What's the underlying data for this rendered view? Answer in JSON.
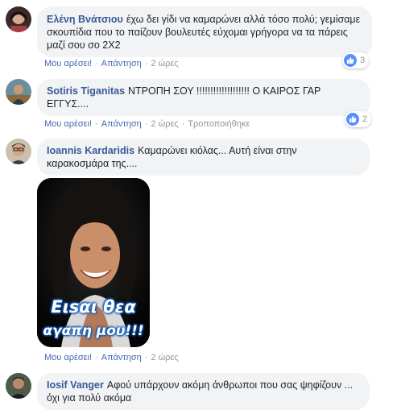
{
  "comments": [
    {
      "author": "Ελένη Βνάτσιου",
      "text": "έχω δει γίδι να καμαρώνει αλλά τόσο πολύ; γεμίσαμε σκουπίδια που το παίζουν βουλευτές εύχομαι γρήγορα να τα πάρεις μαζί σου σο 2Χ2",
      "like_label": "Μου αρέσει!",
      "reply_label": "Απάντηση",
      "time": "2 ώρες",
      "reaction_count": "3"
    },
    {
      "author": "Sotiris Tiganitas",
      "text": "ΝΤΡΟΠΗ ΣΟΥ !!!!!!!!!!!!!!!!!!! Ο ΚΑΙΡΟΣ ΓΑΡ ΕΓΓΥΣ....",
      "like_label": "Μου αρέσει!",
      "reply_label": "Απάντηση",
      "time": "2 ώρες",
      "edited_label": "Τροποποιήθηκε",
      "reaction_count": "2"
    },
    {
      "author": "Ioannis Kardaridis",
      "text": "Καμαρώνει κιόλας... Αυτή είναι στην καρακοσμάρα της....",
      "image_caption_line1": "Ειsαι θεα",
      "image_caption_line2": "αγαπη μου!!!",
      "like_label": "Μου αρέσει!",
      "reply_label": "Απάντηση",
      "time": "2 ώρες"
    },
    {
      "author": "Iosif Vanger",
      "text": "Αφού υπάρχουν ακόμη άνθρωποι που σας ψηφίζουν ... όχι για πολύ ακόμα"
    }
  ],
  "colors": {
    "author": "#385898",
    "link": "#4267b2",
    "meta": "#90949c",
    "bubble": "#f2f3f5",
    "like_badge": "#5890ff"
  },
  "icons": {
    "like": "thumbs-up-icon",
    "separator": "·"
  }
}
